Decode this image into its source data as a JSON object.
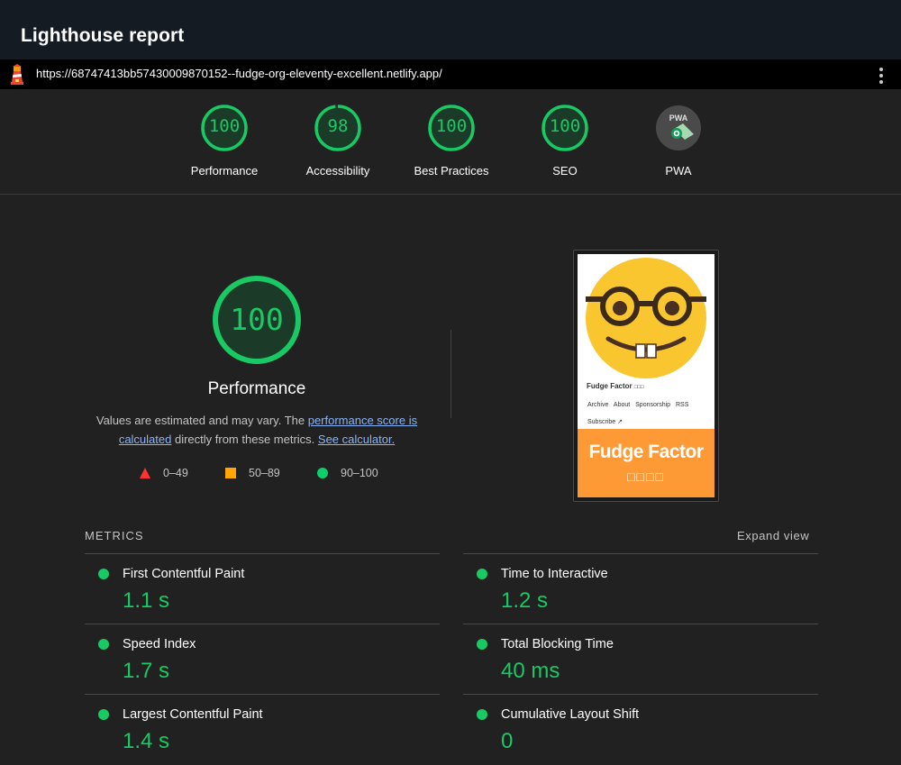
{
  "header": {
    "title": "Lighthouse report"
  },
  "urlbar": {
    "url": "https://68747413bb57430009870152--fudge-org-eleventy-excellent.netlify.app/"
  },
  "scores": [
    {
      "label": "Performance",
      "value": "100",
      "fraction": 1.0
    },
    {
      "label": "Accessibility",
      "value": "98",
      "fraction": 0.98
    },
    {
      "label": "Best Practices",
      "value": "100",
      "fraction": 1.0
    },
    {
      "label": "SEO",
      "value": "100",
      "fraction": 1.0
    },
    {
      "label": "PWA",
      "badge_text": "PWA"
    }
  ],
  "performance": {
    "score": "100",
    "title": "Performance",
    "desc_before": "Values are estimated and may vary. The ",
    "desc_link1": "performance score is calculated",
    "desc_middle": " directly from these metrics. ",
    "desc_link2": "See calculator.",
    "legend": [
      {
        "range": "0–49",
        "shape": "triangle",
        "color": "#ff3333"
      },
      {
        "range": "50–89",
        "shape": "square",
        "color": "#ffa400"
      },
      {
        "range": "90–100",
        "shape": "circle",
        "color": "#0cce6b"
      }
    ]
  },
  "screenshot": {
    "site_name": "Fudge Factor",
    "site_name_suffix": "□□□",
    "nav": "Archive About Sponsorship RSS",
    "subscribe": "Subscribe ↗",
    "banner_title": "Fudge Factor",
    "banner_sub": "□□□□"
  },
  "metrics": {
    "heading": "METRICS",
    "expand_label": "Expand view",
    "left": [
      {
        "name": "First Contentful Paint",
        "value": "1.1 s"
      },
      {
        "name": "Speed Index",
        "value": "1.7 s"
      },
      {
        "name": "Largest Contentful Paint",
        "value": "1.4 s"
      }
    ],
    "right": [
      {
        "name": "Time to Interactive",
        "value": "1.2 s"
      },
      {
        "name": "Total Blocking Time",
        "value": "40 ms"
      },
      {
        "name": "Cumulative Layout Shift",
        "value": "0"
      }
    ]
  },
  "colors": {
    "pass": "#18c964",
    "background": "#212121",
    "titlebar": "#151b23"
  }
}
